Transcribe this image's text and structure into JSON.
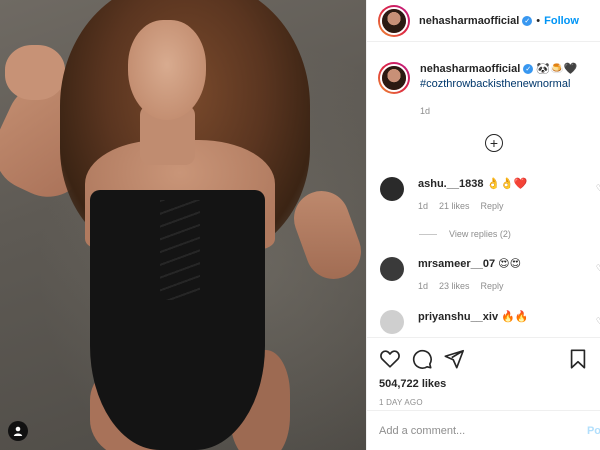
{
  "post": {
    "username": "nehasharmaofficial",
    "follow_label": "Follow",
    "separator": "•",
    "caption_emojis": "🐼🍮🖤",
    "caption_hashtag": "#cozthrowbackisthenewnormal",
    "caption_time": "1d",
    "likes": "504,722 likes",
    "posted_ago": "1 DAY AGO"
  },
  "comments": [
    {
      "username": "ashu.__1838",
      "text": "👌👌❤️",
      "time": "1d",
      "likes": "21 likes",
      "reply": "Reply",
      "avatar_color": "#2a2a2a"
    },
    {
      "username": "mrsameer__07",
      "text": "😍😍",
      "time": "1d",
      "likes": "23 likes",
      "reply": "Reply",
      "avatar_color": "#3a3a3a"
    },
    {
      "username": "priyanshu__xiv",
      "text": "🔥🔥",
      "avatar_color": "#cfcfcf"
    }
  ],
  "view_replies": "View replies (2)",
  "add_comment": {
    "placeholder": "Add a comment...",
    "post_label": "Po"
  },
  "colors": {
    "accent": "#0095f6",
    "verified": "#3897f0"
  }
}
